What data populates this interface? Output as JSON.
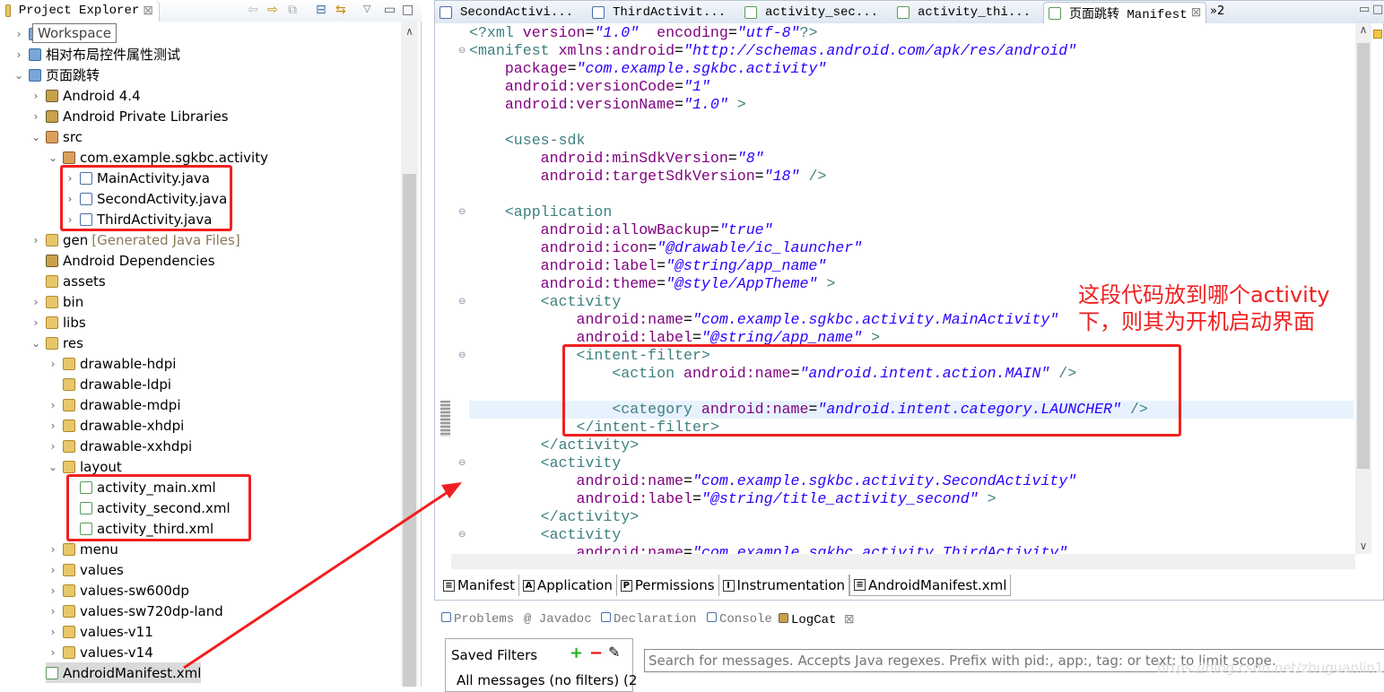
{
  "explorer": {
    "title": "Project Explorer",
    "tooltip": "Workspace",
    "items": [
      {
        "label": "Workspace-hidden",
        "text": "",
        "level": 0,
        "chev": ">",
        "icon": "proj"
      },
      {
        "label": "相对布局控件属性测试",
        "level": 0,
        "chev": ">",
        "icon": "proj"
      },
      {
        "label": "页面跳转",
        "level": 0,
        "chev": "v",
        "icon": "proj"
      },
      {
        "label": "Android 4.4",
        "level": 1,
        "chev": ">",
        "icon": "lib"
      },
      {
        "label": "Android Private Libraries",
        "level": 1,
        "chev": ">",
        "icon": "lib"
      },
      {
        "label": "src",
        "level": 1,
        "chev": "v",
        "icon": "pkg"
      },
      {
        "label": "com.example.sgkbc.activity",
        "level": 2,
        "chev": "v",
        "icon": "pkg"
      },
      {
        "label": "MainActivity.java",
        "level": 3,
        "chev": ">",
        "icon": "jfile"
      },
      {
        "label": "SecondActivity.java",
        "level": 3,
        "chev": ">",
        "icon": "jfile"
      },
      {
        "label": "ThirdActivity.java",
        "level": 3,
        "chev": ">",
        "icon": "jfile"
      },
      {
        "label": "gen",
        "suffix": "[Generated Java Files]",
        "level": 1,
        "chev": ">",
        "icon": "folder"
      },
      {
        "label": "Android Dependencies",
        "level": 1,
        "chev": "",
        "icon": "lib"
      },
      {
        "label": "assets",
        "level": 1,
        "chev": "",
        "icon": "folder"
      },
      {
        "label": "bin",
        "level": 1,
        "chev": ">",
        "icon": "folder"
      },
      {
        "label": "libs",
        "level": 1,
        "chev": ">",
        "icon": "folder"
      },
      {
        "label": "res",
        "level": 1,
        "chev": "v",
        "icon": "folder"
      },
      {
        "label": "drawable-hdpi",
        "level": 2,
        "chev": ">",
        "icon": "folder"
      },
      {
        "label": "drawable-ldpi",
        "level": 2,
        "chev": "",
        "icon": "folder"
      },
      {
        "label": "drawable-mdpi",
        "level": 2,
        "chev": ">",
        "icon": "folder"
      },
      {
        "label": "drawable-xhdpi",
        "level": 2,
        "chev": ">",
        "icon": "folder"
      },
      {
        "label": "drawable-xxhdpi",
        "level": 2,
        "chev": ">",
        "icon": "folder"
      },
      {
        "label": "layout",
        "level": 2,
        "chev": "v",
        "icon": "folder"
      },
      {
        "label": "activity_main.xml",
        "level": 3,
        "chev": "",
        "icon": "xfile"
      },
      {
        "label": "activity_second.xml",
        "level": 3,
        "chev": "",
        "icon": "xfile"
      },
      {
        "label": "activity_third.xml",
        "level": 3,
        "chev": "",
        "icon": "xfile"
      },
      {
        "label": "menu",
        "level": 2,
        "chev": ">",
        "icon": "folder"
      },
      {
        "label": "values",
        "level": 2,
        "chev": ">",
        "icon": "folder"
      },
      {
        "label": "values-sw600dp",
        "level": 2,
        "chev": ">",
        "icon": "folder"
      },
      {
        "label": "values-sw720dp-land",
        "level": 2,
        "chev": ">",
        "icon": "folder"
      },
      {
        "label": "values-v11",
        "level": 2,
        "chev": ">",
        "icon": "folder"
      },
      {
        "label": "values-v14",
        "level": 2,
        "chev": ">",
        "icon": "folder"
      },
      {
        "label": "AndroidManifest.xml",
        "level": 1,
        "chev": "",
        "icon": "xfile",
        "selected": true
      }
    ]
  },
  "editor_tabs": [
    "SecondActivi...",
    "ThirdActivit...",
    "activity_sec...",
    "activity_thi...",
    "页面跳转 Manifest"
  ],
  "editor_overflow": "»2",
  "code_lines": [
    [
      [
        "t",
        "<?xml "
      ],
      [
        "a",
        "version"
      ],
      [
        "",
        "="
      ],
      [
        "v",
        "\"1.0\""
      ],
      [
        "",
        "  "
      ],
      [
        "a",
        "encoding"
      ],
      [
        "",
        "="
      ],
      [
        "v",
        "\"utf-8\""
      ],
      [
        "t",
        "?>"
      ]
    ],
    [
      [
        "t",
        "<manifest "
      ],
      [
        "a",
        "xmlns:android"
      ],
      [
        "",
        "="
      ],
      [
        "v",
        "\"http://schemas.android.com/apk/res/android\""
      ]
    ],
    [
      [
        "",
        "    "
      ],
      [
        "a",
        "package"
      ],
      [
        "",
        "="
      ],
      [
        "v",
        "\"com.example.sgkbc.activity\""
      ]
    ],
    [
      [
        "",
        "    "
      ],
      [
        "a",
        "android:versionCode"
      ],
      [
        "",
        "="
      ],
      [
        "v",
        "\"1\""
      ]
    ],
    [
      [
        "",
        "    "
      ],
      [
        "a",
        "android:versionName"
      ],
      [
        "",
        "="
      ],
      [
        "v",
        "\"1.0\""
      ],
      [
        "t",
        " >"
      ]
    ],
    [],
    [
      [
        "",
        "    "
      ],
      [
        "t",
        "<uses-sdk"
      ]
    ],
    [
      [
        "",
        "        "
      ],
      [
        "a",
        "android:minSdkVersion"
      ],
      [
        "",
        "="
      ],
      [
        "v",
        "\"8\""
      ]
    ],
    [
      [
        "",
        "        "
      ],
      [
        "a",
        "android:targetSdkVersion"
      ],
      [
        "",
        "="
      ],
      [
        "v",
        "\"18\""
      ],
      [
        "t",
        " />"
      ]
    ],
    [],
    [
      [
        "",
        "    "
      ],
      [
        "t",
        "<application"
      ]
    ],
    [
      [
        "",
        "        "
      ],
      [
        "a",
        "android:allowBackup"
      ],
      [
        "",
        "="
      ],
      [
        "v",
        "\"true\""
      ]
    ],
    [
      [
        "",
        "        "
      ],
      [
        "a",
        "android:icon"
      ],
      [
        "",
        "="
      ],
      [
        "v",
        "\"@drawable/ic_launcher\""
      ]
    ],
    [
      [
        "",
        "        "
      ],
      [
        "a",
        "android:label"
      ],
      [
        "",
        "="
      ],
      [
        "v",
        "\"@string/app_name\""
      ]
    ],
    [
      [
        "",
        "        "
      ],
      [
        "a",
        "android:theme"
      ],
      [
        "",
        "="
      ],
      [
        "v",
        "\"@style/AppTheme\""
      ],
      [
        "t",
        " >"
      ]
    ],
    [
      [
        "",
        "        "
      ],
      [
        "t",
        "<activity"
      ]
    ],
    [
      [
        "",
        "            "
      ],
      [
        "a",
        "android:name"
      ],
      [
        "",
        "="
      ],
      [
        "v",
        "\"com.example.sgkbc.activity.MainActivity\""
      ]
    ],
    [
      [
        "",
        "            "
      ],
      [
        "a",
        "android:label"
      ],
      [
        "",
        "="
      ],
      [
        "v",
        "\"@string/app_name\""
      ],
      [
        "t",
        " >"
      ]
    ],
    [
      [
        "",
        "            "
      ],
      [
        "t",
        "<intent-filter>"
      ]
    ],
    [
      [
        "",
        "                "
      ],
      [
        "t",
        "<action "
      ],
      [
        "a",
        "android:name"
      ],
      [
        "",
        "="
      ],
      [
        "v",
        "\"android.intent.action.MAIN\""
      ],
      [
        "t",
        " />"
      ]
    ],
    [],
    [
      [
        "",
        "                "
      ],
      [
        "t",
        "<category "
      ],
      [
        "a",
        "android:name"
      ],
      [
        "",
        "="
      ],
      [
        "v",
        "\"android.intent.category.LAUNCHER\""
      ],
      [
        "t",
        " />"
      ]
    ],
    [
      [
        "",
        "            "
      ],
      [
        "t",
        "</intent-filter>"
      ]
    ],
    [
      [
        "",
        "        "
      ],
      [
        "t",
        "</activity>"
      ]
    ],
    [
      [
        "",
        "        "
      ],
      [
        "t",
        "<activity"
      ]
    ],
    [
      [
        "",
        "            "
      ],
      [
        "a",
        "android:name"
      ],
      [
        "",
        "="
      ],
      [
        "v",
        "\"com.example.sgkbc.activity.SecondActivity\""
      ]
    ],
    [
      [
        "",
        "            "
      ],
      [
        "a",
        "android:label"
      ],
      [
        "",
        "="
      ],
      [
        "v",
        "\"@string/title_activity_second\""
      ],
      [
        "t",
        " >"
      ]
    ],
    [
      [
        "",
        "        "
      ],
      [
        "t",
        "</activity>"
      ]
    ],
    [
      [
        "",
        "        "
      ],
      [
        "t",
        "<activity"
      ]
    ],
    [
      [
        "",
        "            "
      ],
      [
        "a",
        "android:name"
      ],
      [
        "",
        "="
      ],
      [
        "v",
        "\"com.example.sgkbc.activity.ThirdActivity\""
      ]
    ]
  ],
  "bottom_editor_tabs": [
    {
      "label": "Manifest",
      "icon": "≡"
    },
    {
      "label": "Application",
      "icon": "A"
    },
    {
      "label": "Permissions",
      "icon": "P"
    },
    {
      "label": "Instrumentation",
      "icon": "I"
    },
    {
      "label": "AndroidManifest.xml",
      "icon": "≡",
      "active": true
    }
  ],
  "views": [
    "Problems",
    "@ Javadoc",
    "Declaration",
    "Console",
    "LogCat"
  ],
  "logcat": {
    "saved_filters": "Saved Filters",
    "add": "+",
    "remove": "−",
    "edit": "✎",
    "all_messages": "All messages (no filters) (2",
    "search_placeholder": "Search for messages. Accepts Java regexes. Prefix with pid:, app:, tag: or text: to limit scope."
  },
  "annotation": {
    "line1": "这段代码放到哪个activity",
    "line2": "下，则其为开机启动界面"
  },
  "watermark": "https://blog.csdn.net/zhuguanlin121",
  "colors": {
    "tag": "#3f7f7f",
    "attr": "#7f007f",
    "value": "#2a00ff",
    "annotation": "#f02020"
  }
}
